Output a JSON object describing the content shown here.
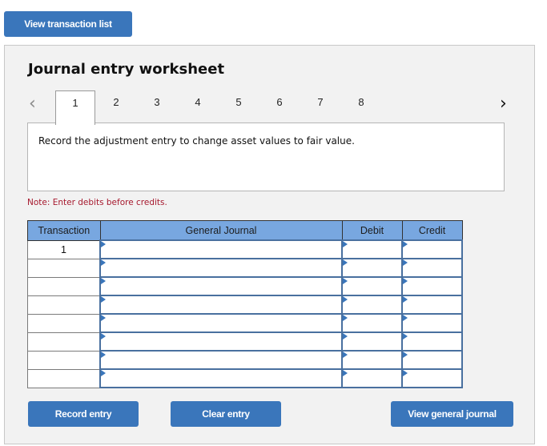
{
  "top_button": {
    "label": "View transaction list"
  },
  "worksheet": {
    "title": "Journal entry worksheet",
    "nav": {
      "prev_icon": "chevron-left-icon",
      "next_icon": "chevron-right-icon",
      "prev_glyph": "‹",
      "next_glyph": "›"
    },
    "tabs": [
      {
        "label": "1",
        "active": true
      },
      {
        "label": "2",
        "active": false
      },
      {
        "label": "3",
        "active": false
      },
      {
        "label": "4",
        "active": false
      },
      {
        "label": "5",
        "active": false
      },
      {
        "label": "6",
        "active": false
      },
      {
        "label": "7",
        "active": false
      },
      {
        "label": "8",
        "active": false
      }
    ],
    "prompt": "Record the adjustment entry to change asset values to fair value.",
    "note": "Note: Enter debits before credits."
  },
  "table": {
    "headers": {
      "transaction": "Transaction",
      "general_journal": "General Journal",
      "debit": "Debit",
      "credit": "Credit"
    },
    "rows": [
      {
        "transaction": "1",
        "account": "",
        "debit": "",
        "credit": ""
      },
      {
        "transaction": "",
        "account": "",
        "debit": "",
        "credit": ""
      },
      {
        "transaction": "",
        "account": "",
        "debit": "",
        "credit": ""
      },
      {
        "transaction": "",
        "account": "",
        "debit": "",
        "credit": ""
      },
      {
        "transaction": "",
        "account": "",
        "debit": "",
        "credit": ""
      },
      {
        "transaction": "",
        "account": "",
        "debit": "",
        "credit": ""
      },
      {
        "transaction": "",
        "account": "",
        "debit": "",
        "credit": ""
      },
      {
        "transaction": "",
        "account": "",
        "debit": "",
        "credit": ""
      }
    ]
  },
  "actions": {
    "record": "Record entry",
    "clear": "Clear entry",
    "view_general_journal": "View general journal"
  },
  "colors": {
    "button_bg": "#3a76bb",
    "header_bg": "#78a7e0",
    "note_color": "#a6192e",
    "cell_border": "#49709f"
  }
}
